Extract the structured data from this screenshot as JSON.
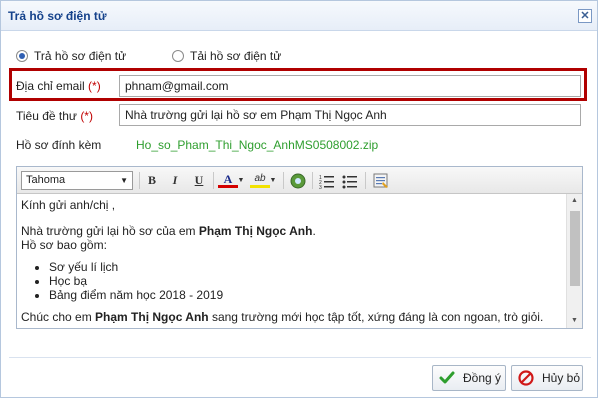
{
  "dialog": {
    "title": "Trả hồ sơ điện tử",
    "close_glyph": "✕"
  },
  "mode": {
    "options": [
      {
        "label": "Trả hồ sơ điện tử",
        "selected": true
      },
      {
        "label": "Tải hồ sơ điện tử",
        "selected": false
      }
    ]
  },
  "form": {
    "email": {
      "label": "Địa chỉ email",
      "required_mark": "(*)",
      "value": "phnam@gmail.com"
    },
    "subject": {
      "label": "Tiêu đề thư",
      "required_mark": "(*)",
      "value": "Nhà trường gửi lại hồ sơ em Phạm Thị Ngọc Anh"
    },
    "attachment": {
      "label": "Hồ sơ đính kèm",
      "file": "Ho_so_Pham_Thi_Ngoc_AnhMS0508002.zip"
    }
  },
  "editor": {
    "font": "Tahoma",
    "toolbar": {
      "bold": "B",
      "italic": "I",
      "underline": "U",
      "font_color": "A",
      "highlight": "ab",
      "icons": [
        "bold-icon",
        "italic-icon",
        "underline-icon",
        "font-color-icon",
        "highlight-icon",
        "insert-link-icon",
        "ordered-list-icon",
        "unordered-list-icon",
        "html-source-icon"
      ]
    },
    "body": {
      "greeting": "Kính gửi anh/chị  ,",
      "intro": "Nhà trường gửi lại hồ sơ của em ",
      "student_name": "Phạm Thị Ngọc Anh",
      "intro_end": ".",
      "list_heading": "Hồ sơ bao gồm:",
      "items": [
        "Sơ yếu lí lịch",
        "Học bạ",
        "Bảng điểm năm học 2018 - 2019"
      ],
      "closing_pre": "Chúc cho em ",
      "closing_name": "Phạm Thị Ngọc Anh",
      "closing_post": " sang trường mới học tập tốt, xứng đáng là con ngoan, trò giỏi."
    }
  },
  "buttons": {
    "ok": "Đồng ý",
    "cancel": "Hủy bỏ"
  },
  "colors": {
    "highlight_border": "#b00000",
    "required": "#c00000",
    "link": "#2e9e2e",
    "title": "#15428b"
  }
}
